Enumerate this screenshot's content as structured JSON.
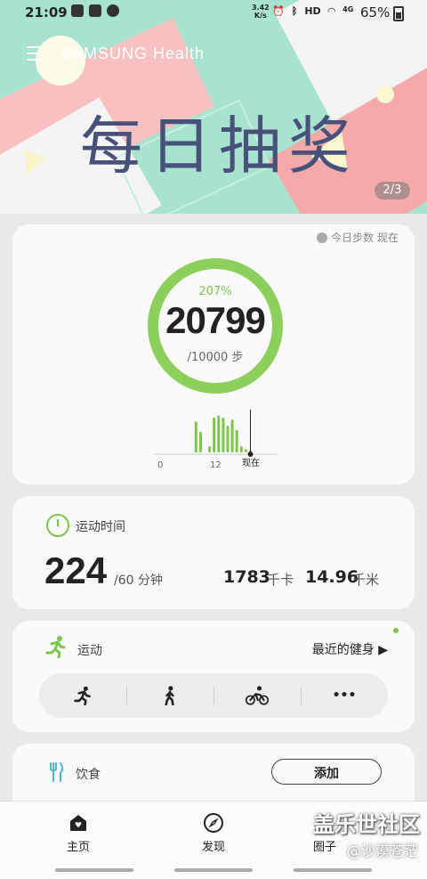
{
  "status_bar": {
    "time": "21:09",
    "net_speed_value": "3.42",
    "net_speed_unit": "K/s",
    "hd": "HD",
    "lte": "4G",
    "battery": "65%"
  },
  "banner": {
    "brand": "SAMSUNG Health",
    "headline": "每日抽奖",
    "pager": "2/3"
  },
  "steps_card": {
    "corner_label": "今日步数 现在",
    "percent": "207%",
    "steps": "20799",
    "goal": "/10000 步",
    "progress_fraction": 1.0,
    "tick_start": "0",
    "tick_mid": "12",
    "now_label": "现在",
    "hourly_bars": [
      0,
      0,
      0,
      0,
      0,
      0,
      0,
      0,
      0.75,
      0.5,
      0,
      0.15,
      0.85,
      0.9,
      0.85,
      0.65,
      0.8,
      0.55,
      0.15,
      0.08,
      0.05
    ]
  },
  "activity_time_card": {
    "title": "运动时间",
    "minutes": "224",
    "minutes_goal": "/60 分钟",
    "kcal_value": "1783",
    "kcal_unit": "千卡",
    "distance_value": "14.96",
    "distance_unit": "千米"
  },
  "exercise_card": {
    "title": "运动",
    "recent_label": "最近的健身 ▶",
    "more_label": "•••"
  },
  "food_card": {
    "title": "饮食",
    "add_label": "添加"
  },
  "bottom_nav": {
    "home": "主页",
    "discover": "发现",
    "community": "圈子"
  },
  "watermark": {
    "line1": "盖乐世社区",
    "line2": "@沙漠苍茫"
  },
  "colors": {
    "accent_green": "#7ec54f",
    "banner_mint": "#a7e3cf",
    "banner_pink": "#f5a9a9",
    "headline": "#47517a"
  }
}
